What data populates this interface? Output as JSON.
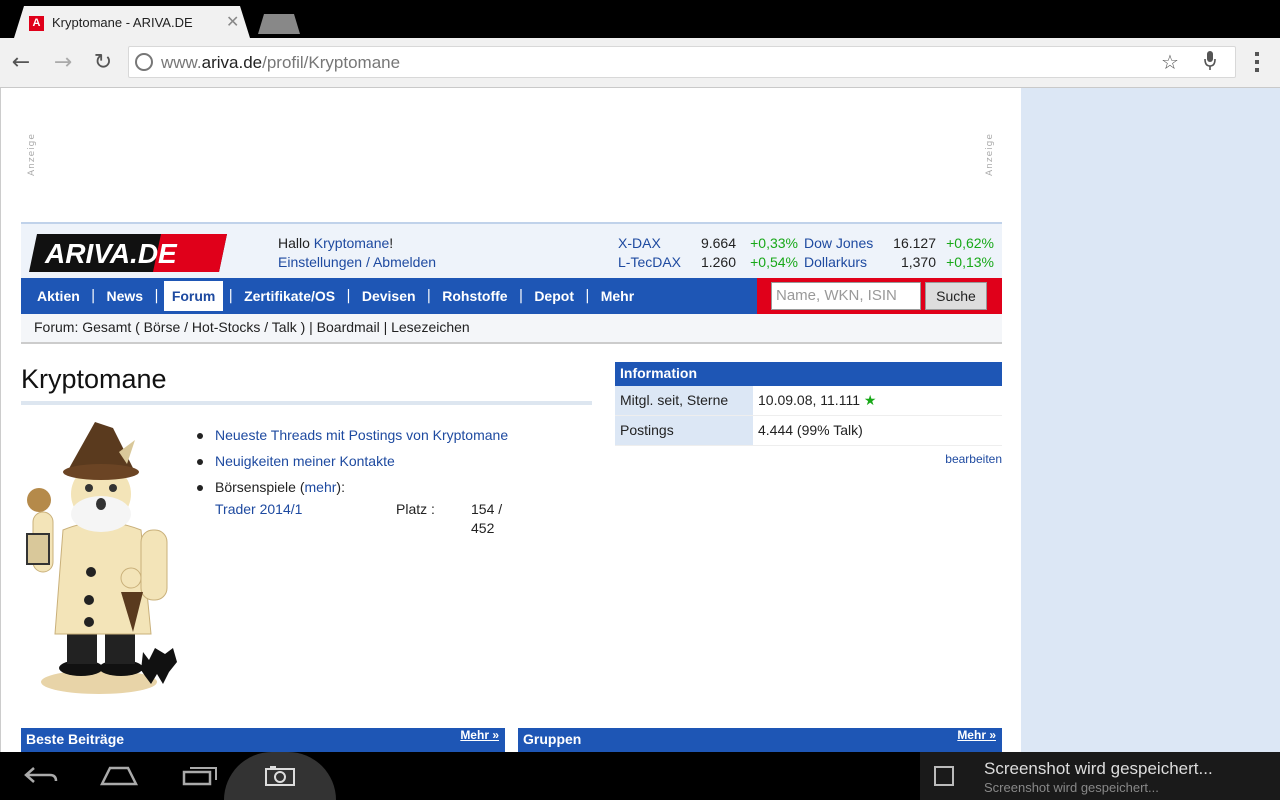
{
  "browser": {
    "tab_title": "Kryptomane - ARIVA.DE",
    "tab_favicon": "A",
    "url_prefix": "www.",
    "url_host": "ariva.de",
    "url_path": "/profil/Kryptomane",
    "icons": [
      "back-icon",
      "forward-icon",
      "reload-icon",
      "globe-icon",
      "star-icon",
      "mic-icon",
      "menu-icon"
    ]
  },
  "ads": {
    "label": "Anzeige"
  },
  "header": {
    "logo_text": "ARIVA.DE",
    "greeting_prefix": "Hallo ",
    "user": "Kryptomane",
    "greeting_suffix": "!",
    "settings": "Einstellungen",
    "sep": " / ",
    "logout": "Abmelden",
    "tickers": [
      {
        "name": "X-DAX",
        "value": "9.664",
        "change": "+0,33%"
      },
      {
        "name": "L-TecDAX",
        "value": "1.260",
        "change": "+0,54%"
      },
      {
        "name": "Dow Jones",
        "value": "16.127",
        "change": "+0,62%"
      },
      {
        "name": "Dollarkurs",
        "value": "1,370",
        "change": "+0,13%"
      }
    ]
  },
  "nav": {
    "items": [
      "Aktien",
      "News",
      "Forum",
      "Zertifikate/OS",
      "Devisen",
      "Rohstoffe",
      "Depot",
      "Mehr"
    ],
    "active": "Forum",
    "search_placeholder": "Name, WKN, ISIN",
    "search_button": "Suche"
  },
  "subnav": {
    "text": "Forum: Gesamt ( Börse / Hot-Stocks / Talk ) | Boardmail | Lesezeichen"
  },
  "profile": {
    "name": "Kryptomane",
    "links": [
      "Neueste Threads mit Postings von Kryptomane",
      "Neuigkeiten meiner Kontakte"
    ],
    "games_label": "Börsenspiele (",
    "games_more": "mehr",
    "games_suffix": "):",
    "game_name": "Trader 2014/1",
    "game_rank_label": "Platz :",
    "game_rank": "154 / 452"
  },
  "info": {
    "title": "Information",
    "rows": [
      {
        "key": "Mitgl. seit, Sterne",
        "value": "10.09.08, 11.111"
      },
      {
        "key": "Postings",
        "value": "4.444 (99% Talk)"
      }
    ],
    "star": "★",
    "edit": "bearbeiten"
  },
  "boxes": [
    {
      "title": "Beste Beiträge",
      "more": "Mehr »"
    },
    {
      "title": "Gruppen",
      "more": "Mehr »"
    }
  ],
  "system": {
    "notif_title": "Screenshot wird gespeichert...",
    "notif_sub": "Screenshot wird gespeichert..."
  }
}
